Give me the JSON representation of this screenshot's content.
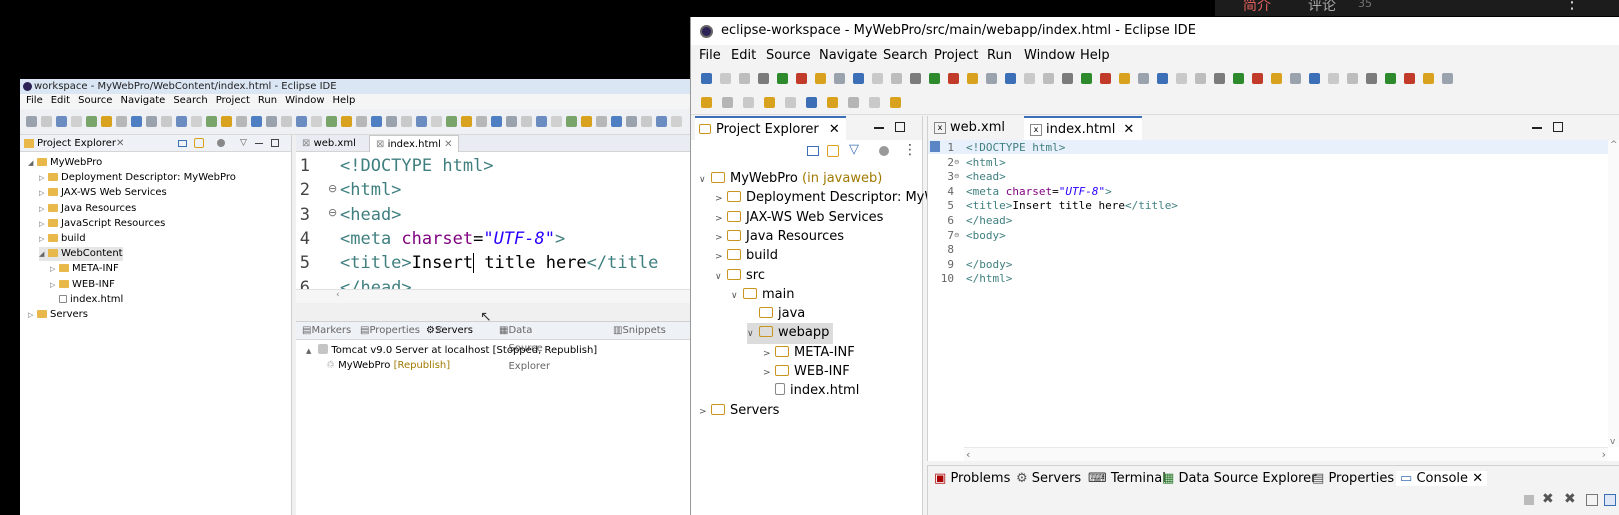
{
  "top_strip": {
    "tab_intro": "简介",
    "tab_comments": "评论",
    "comment_count": "35",
    "menu_glyph": "⋮"
  },
  "left_window": {
    "title": "workspace - MyWebPro/WebContent/index.html - Eclipse IDE",
    "menu": [
      "File",
      "Edit",
      "Source",
      "Navigate",
      "Search",
      "Project",
      "Run",
      "Window",
      "Help"
    ],
    "project_explorer": {
      "label": "Project Explorer",
      "items": [
        {
          "label": "MyWebPro",
          "depth": 0,
          "expanded": true
        },
        {
          "label": "Deployment Descriptor: MyWebPro",
          "depth": 1
        },
        {
          "label": "JAX-WS Web Services",
          "depth": 1
        },
        {
          "label": "Java Resources",
          "depth": 1
        },
        {
          "label": "JavaScript Resources",
          "depth": 1
        },
        {
          "label": "build",
          "depth": 1
        },
        {
          "label": "WebContent",
          "depth": 1,
          "expanded": true
        },
        {
          "label": "META-INF",
          "depth": 2
        },
        {
          "label": "WEB-INF",
          "depth": 2
        },
        {
          "label": "index.html",
          "depth": 2
        },
        {
          "label": "Servers",
          "depth": 0
        }
      ]
    },
    "editor_tabs": [
      "web.xml",
      "index.html"
    ],
    "code_lines": [
      {
        "num": "1",
        "text": "<!DOCTYPE html>"
      },
      {
        "num": "2",
        "text": "<html>"
      },
      {
        "num": "3",
        "text": "<head>"
      },
      {
        "num": "4",
        "pre": "<meta ",
        "attr": "charset",
        "eq": "=",
        "val": "\"UTF-8\"",
        "post": ">"
      },
      {
        "num": "5",
        "pre": "<title>",
        "t1": "Insert",
        "t2": " title here",
        "post": "</title"
      },
      {
        "num": "6",
        "text": "</head>"
      }
    ],
    "bottom_tabs": [
      "Markers",
      "Properties",
      "Servers",
      "Data Source Explorer",
      "Snippets"
    ],
    "servers": [
      {
        "label": "Tomcat v9.0 Server at localhost",
        "status": "[Stopped, Republish]"
      },
      {
        "label": "MyWebPro",
        "status": "[Republish]"
      }
    ]
  },
  "right_window": {
    "title": "eclipse-workspace - MyWebPro/src/main/webapp/index.html - Eclipse IDE",
    "menu": [
      "File",
      "Edit",
      "Source",
      "Navigate",
      "Search",
      "Project",
      "Run",
      "Window",
      "Help"
    ],
    "project_explorer": {
      "label": "Project Explorer",
      "items": [
        {
          "label": "MyWebPro",
          "suffix": "(in javaweb)",
          "depth": 0,
          "expanded": true
        },
        {
          "label": "Deployment Descriptor: MyWe",
          "depth": 1
        },
        {
          "label": "JAX-WS Web Services",
          "depth": 1
        },
        {
          "label": "Java Resources",
          "depth": 1
        },
        {
          "label": "build",
          "depth": 1
        },
        {
          "label": "src",
          "depth": 1,
          "expanded": true
        },
        {
          "label": "main",
          "depth": 2,
          "expanded": true
        },
        {
          "label": "java",
          "depth": 3
        },
        {
          "label": "webapp",
          "depth": 3,
          "expanded": true,
          "selected": true
        },
        {
          "label": "META-INF",
          "depth": 4
        },
        {
          "label": "WEB-INF",
          "depth": 4
        },
        {
          "label": "index.html",
          "depth": 4
        },
        {
          "label": "Servers",
          "depth": 0
        }
      ]
    },
    "editor_tabs": [
      "web.xml",
      "index.html"
    ],
    "code_lines": [
      {
        "num": "1",
        "text": "<!DOCTYPE html>"
      },
      {
        "num": "2",
        "text": "<html>"
      },
      {
        "num": "3",
        "text": "<head>"
      },
      {
        "num": "4",
        "pre": "<meta ",
        "attr": "charset",
        "eq": "=",
        "val": "\"UTF-8\"",
        "post": ">"
      },
      {
        "num": "5",
        "pre": "<title>",
        "tx": "Insert title here",
        "post": "</title>"
      },
      {
        "num": "6",
        "text": "</head>"
      },
      {
        "num": "7",
        "text": "<body>"
      },
      {
        "num": "8",
        "text": ""
      },
      {
        "num": "9",
        "text": "</body>"
      },
      {
        "num": "10",
        "text": "</html>"
      }
    ],
    "console_tabs": [
      "Problems",
      "Servers",
      "Terminal",
      "Data Source Explorer",
      "Properties",
      "Console"
    ]
  }
}
